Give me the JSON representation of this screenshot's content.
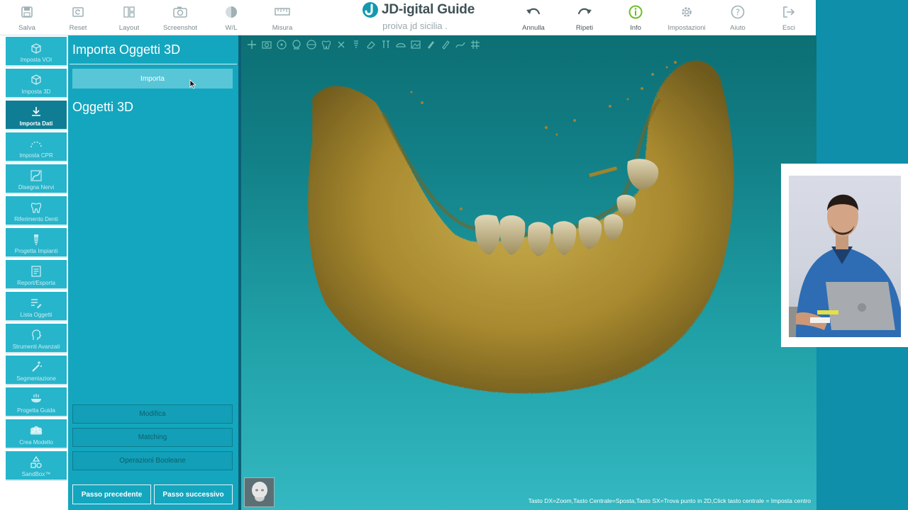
{
  "toolbar": {
    "left": [
      {
        "label": "Salva",
        "icon": "save-icon"
      },
      {
        "label": "Reset",
        "icon": "reset-icon"
      },
      {
        "label": "Layout",
        "icon": "layout-icon"
      },
      {
        "label": "Screenshot",
        "icon": "camera-icon"
      },
      {
        "label": "W/L",
        "icon": "contrast-icon"
      },
      {
        "label": "Misura",
        "icon": "ruler-icon"
      }
    ],
    "right": [
      {
        "label": "Annulla",
        "icon": "undo-icon"
      },
      {
        "label": "Ripeti",
        "icon": "redo-icon"
      },
      {
        "label": "Info",
        "icon": "info-icon"
      },
      {
        "label": "Impostazioni",
        "icon": "gear-icon"
      },
      {
        "label": "Aiuto",
        "icon": "help-icon"
      },
      {
        "label": "Esci",
        "icon": "exit-icon"
      }
    ],
    "brand_title": "JD-igital Guide",
    "brand_subtitle": "proiva jd sicilia ."
  },
  "sidebar": {
    "items": [
      {
        "label": "Imposta VOI"
      },
      {
        "label": "Imposta 3D"
      },
      {
        "label": "Importa Dati",
        "active": true
      },
      {
        "label": "Imposta CPR"
      },
      {
        "label": "Disegna Nervi"
      },
      {
        "label": "Riferimento Denti"
      },
      {
        "label": "Progetta Impianti"
      },
      {
        "label": "Report/Esporta"
      },
      {
        "label": "Lista Oggetti"
      },
      {
        "label": "Strumenti Avanzati"
      },
      {
        "label": "Segmentazione"
      },
      {
        "label": "Progetta Guida"
      },
      {
        "label": "Crea Modello"
      },
      {
        "label": "SandBox™"
      }
    ]
  },
  "panel": {
    "title": "Importa Oggetti 3D",
    "import_label": "Importa",
    "objects_title": "Oggetti 3D",
    "ops": [
      "Modifica",
      "Matching",
      "Operazioni Booleane"
    ],
    "prev_label": "Passo precedente",
    "next_label": "Passo successivo"
  },
  "viewport": {
    "hint": "Tasto DX=Zoom,Tasto Centrale=Sposta,Tasto SX=Trova punto in 2D,Click tasto centrale = Imposta centro"
  },
  "colors": {
    "accent": "#14a6bf",
    "accent_dark": "#0f7e95",
    "info_green": "#6cc024",
    "bone": "#b59a3c"
  }
}
